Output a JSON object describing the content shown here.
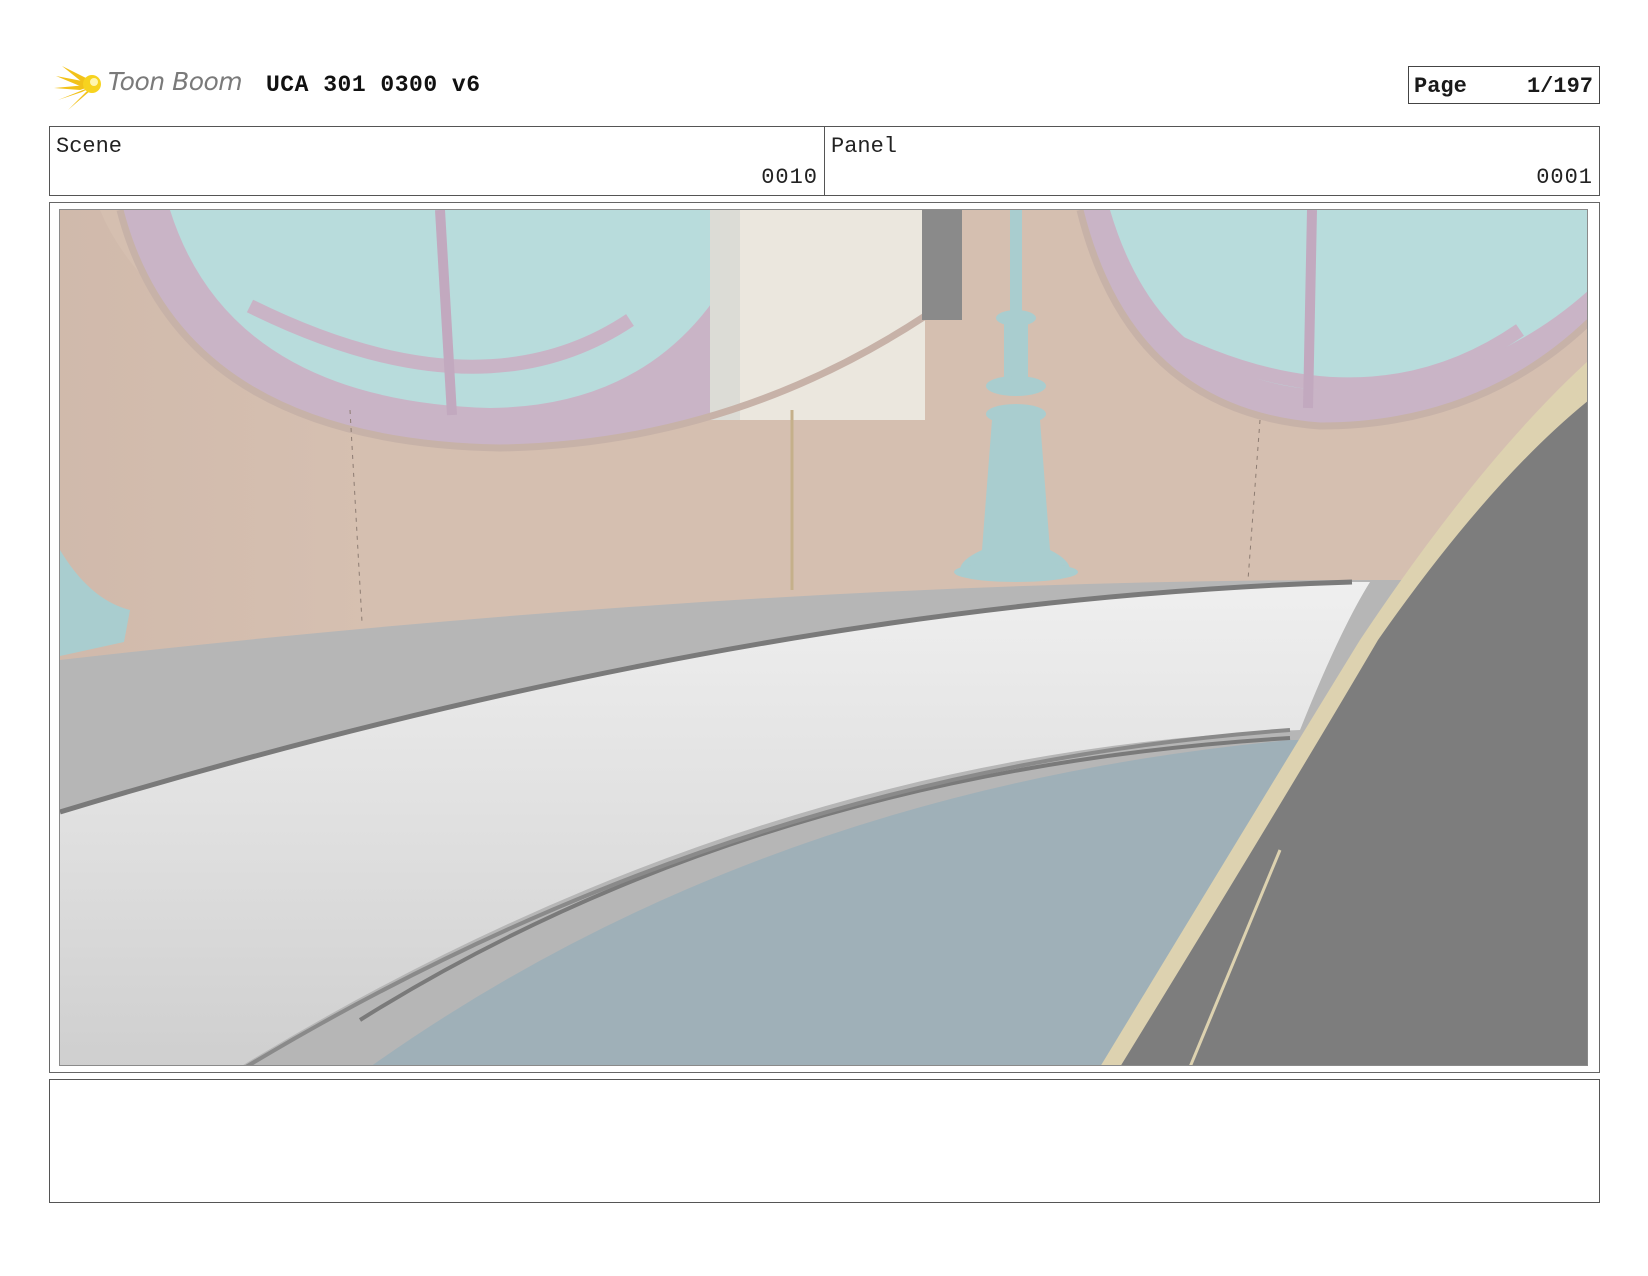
{
  "header": {
    "brand": "Toon Boom",
    "brand_icon": "toon-boom-star-logo",
    "title": "UCA 301 0300 v6",
    "page_label": "Page",
    "page_number": "1/197"
  },
  "info": {
    "scene_label": "Scene",
    "scene_value": "0010",
    "panel_label": "Panel",
    "panel_value": "0001"
  },
  "panel": {
    "colors": {
      "wall": "#d5bfb0",
      "window_glass": "#b8dcdc",
      "window_frame": "#c9b4c6",
      "floor_top": "#b6b6b6",
      "bench": "#e2e2e2",
      "bench_seat": "#9fb0b8",
      "lamp_post": "#a9cdcf",
      "foreground": "#7d7d7d",
      "cream_accent": "#ddd2b0"
    }
  },
  "notes": {
    "text": ""
  }
}
